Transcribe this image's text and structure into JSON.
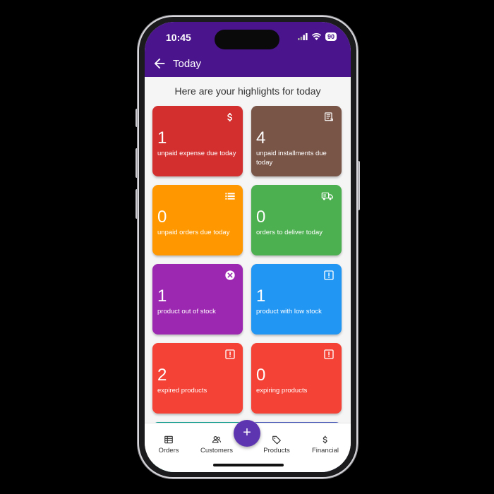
{
  "status_bar": {
    "time": "10:45",
    "battery": "90"
  },
  "app_bar": {
    "title": "Today",
    "back_icon": "arrow-left-icon"
  },
  "heading": "Here are your highlights for today",
  "cards": [
    {
      "count": "1",
      "label": "unpaid expense due today",
      "icon": "dollar-icon",
      "color": "#d32f2f"
    },
    {
      "count": "4",
      "label": "unpaid installments due today",
      "icon": "receipt-icon",
      "color": "#795548"
    },
    {
      "count": "0",
      "label": "unpaid orders due today",
      "icon": "list-icon",
      "color": "#ff9800"
    },
    {
      "count": "0",
      "label": "orders to deliver today",
      "icon": "truck-icon",
      "color": "#4caf50"
    },
    {
      "count": "1",
      "label": "product out of stock",
      "icon": "close-circle-icon",
      "color": "#9c27b0"
    },
    {
      "count": "1",
      "label": "product with low stock",
      "icon": "alert-icon",
      "color": "#2196f3"
    },
    {
      "count": "2",
      "label": "expired products",
      "icon": "alert-icon",
      "color": "#f44336"
    },
    {
      "count": "0",
      "label": "expiring products",
      "icon": "alert-icon",
      "color": "#f44336"
    }
  ],
  "fab": {
    "label": "+",
    "color": "#5e35b1"
  },
  "bottom_nav": [
    {
      "label": "Orders",
      "icon": "orders-icon"
    },
    {
      "label": "Customers",
      "icon": "customers-icon"
    },
    {
      "label": "Products",
      "icon": "tag-icon"
    },
    {
      "label": "Financial",
      "icon": "dollar-icon"
    }
  ],
  "colors": {
    "primary": "#4a148c",
    "background": "#f5f5f5",
    "partial_teal": "#009688",
    "partial_indigo": "#3f51b5"
  }
}
